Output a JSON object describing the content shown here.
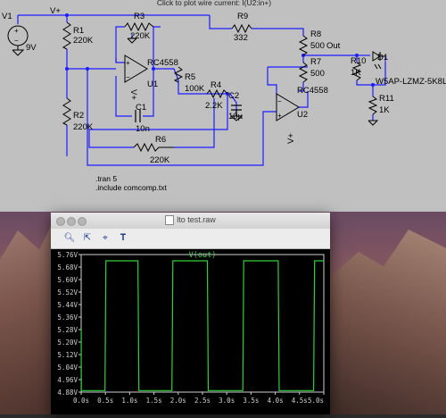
{
  "schematic": {
    "hint": "Click to plot wire current: I(U2:in+)",
    "labels": {
      "v1": "V1",
      "v1_val": "9V",
      "vplus_top": "V+",
      "r1": "R1",
      "r1_val": "220K",
      "r2": "R2",
      "r2_val": "220K",
      "r3": "R3",
      "r3_val": "220K",
      "r4": "R4",
      "r4_val": "2.2K",
      "r5": "R5",
      "r5_val": "100K",
      "r6": "R6",
      "r6_val": "220K",
      "r7": "R7",
      "r7_val": "500",
      "r8": "R8",
      "r8_val": "500",
      "r9": "R9",
      "r9_val": "332",
      "r10": "R10",
      "r10_val": "1K",
      "r11": "R11",
      "r11_val": "1K",
      "c1": "C1",
      "c1_val": "10n",
      "c2": "C2",
      "c2_val": "10µ",
      "u1": "U1",
      "u1_part": "RC4558",
      "u2": "U2",
      "u2_part": "RC4558",
      "d1": "D1",
      "d1_part": "W5AP-LZMZ-5K8L",
      "net_out": "Out",
      "u1_vplus": "V+",
      "u2_vplus": "V+"
    },
    "directives": [
      ".tran 5",
      ".include comcomp.txt"
    ]
  },
  "window": {
    "title": "lto test.raw",
    "toolbar": [
      "zoom-icon",
      "autorange-icon",
      "cursor-icon",
      "label-icon"
    ]
  },
  "chart_data": {
    "type": "line",
    "title": "V(out)",
    "xlabel": "",
    "ylabel": "",
    "xlim": [
      0,
      5.0
    ],
    "ylim": [
      4.88,
      5.76
    ],
    "x_ticks": [
      "0.0s",
      "0.5s",
      "1.0s",
      "1.5s",
      "2.0s",
      "2.5s",
      "3.0s",
      "3.5s",
      "4.0s",
      "4.5s",
      "5.0s"
    ],
    "y_ticks": [
      "5.76V",
      "5.68V",
      "5.60V",
      "5.52V",
      "5.44V",
      "5.36V",
      "5.28V",
      "5.20V",
      "5.12V",
      "5.04V",
      "4.96V",
      "4.88V"
    ],
    "colors": {
      "trace": "#2fd13a",
      "axis": "#d0d0d0",
      "text": "#d0d0d0",
      "bg": "#000000"
    },
    "series": [
      {
        "x": [
          0.0,
          0.001,
          0.002,
          0.003,
          0.05,
          0.49,
          0.5,
          0.51,
          1.17,
          1.18,
          1.19,
          1.87,
          1.88,
          1.89,
          2.6,
          2.61,
          2.62,
          3.33,
          3.34,
          3.35,
          4.06,
          4.07,
          4.08,
          4.79,
          4.8,
          4.81,
          5.0
        ],
        "y": [
          5.28,
          5.28,
          5.1,
          4.89,
          4.89,
          4.89,
          5.3,
          5.72,
          5.72,
          5.3,
          4.89,
          4.89,
          5.3,
          5.72,
          5.72,
          5.3,
          4.89,
          4.89,
          5.3,
          5.72,
          5.72,
          5.3,
          4.89,
          4.89,
          5.3,
          5.72,
          5.72
        ]
      }
    ]
  }
}
